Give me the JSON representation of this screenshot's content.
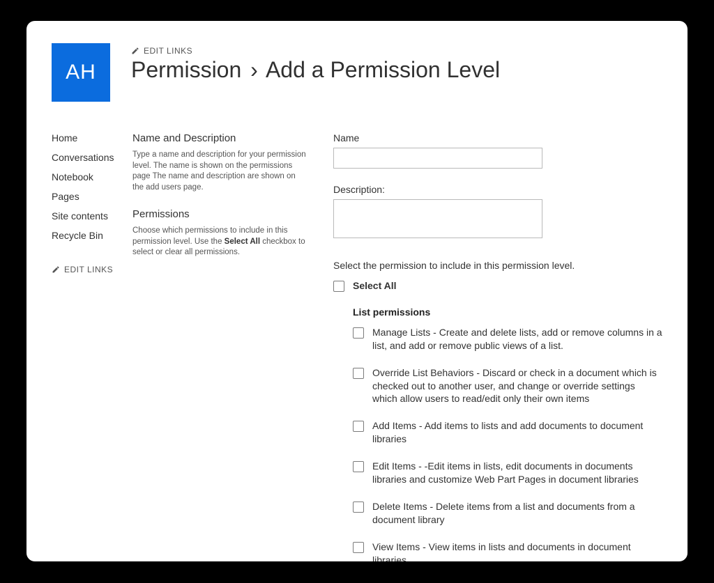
{
  "logo_text": "AH",
  "edit_links_label": "EDIT LINKS",
  "title_parent": "Permission",
  "title_separator": "›",
  "title_child": "Add a Permission Level",
  "nav": [
    "Home",
    "Conversations",
    "Notebook",
    "Pages",
    "Site contents",
    "Recycle Bin"
  ],
  "help": {
    "nd_title": "Name and Description",
    "nd_text": "Type a name and description for your permission level. The name is shown on the permissions page The name and description are shown on the add users page.",
    "perm_title": "Permissions",
    "perm_text_a": "Choose which permissions to include in this permission level. Use the ",
    "perm_text_bold": "Select All",
    "perm_text_b": " checkbox to select or clear all permissions."
  },
  "form": {
    "name_label": "Name",
    "name_value": "",
    "desc_label": "Description:",
    "desc_value": "",
    "hint": "Select the permission to include in this permission level.",
    "select_all_label": "Select All",
    "group_header": "List permissions",
    "perms": [
      "Manage Lists - Create and delete lists, add or remove columns in a list, and add or remove public views of a list.",
      "Override List Behaviors - Discard or check in a document which is checked out to another user, and change or override settings which allow users to read/edit only their own items",
      "Add Items - Add items to lists and add documents to document libraries",
      "Edit Items - -Edit items in lists, edit documents in documents libraries and customize Web Part Pages in document libraries",
      "Delete Items - Delete items from a list and documents from a document library",
      "View Items - View items in lists and documents in document libraries"
    ]
  }
}
